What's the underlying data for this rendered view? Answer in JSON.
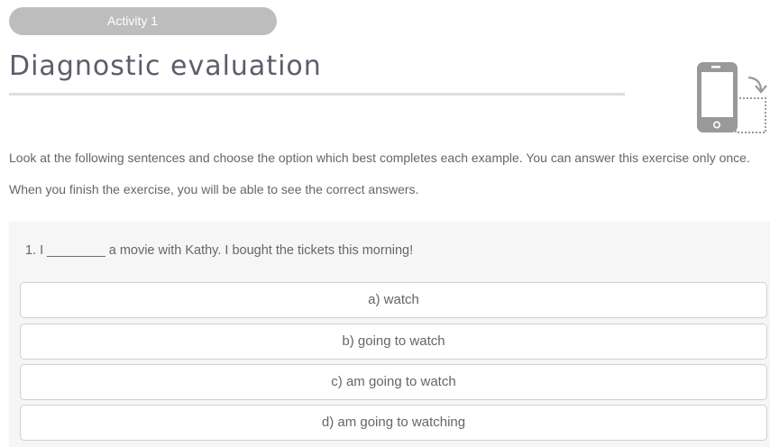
{
  "header": {
    "activity_label": "Activity 1",
    "title": "Diagnostic evaluation",
    "rotate_icon": "rotate-device-icon"
  },
  "instructions": "Look at the following sentences and choose the option which best completes each example. You can answer this exercise only once. When you finish the exercise, you will be able to see the correct answers.",
  "question": {
    "text": "1. I ________ a movie with Kathy. I bought the tickets this morning!",
    "options": [
      "a) watch",
      "b) going to watch",
      "c) am going to watch",
      "d) am going to watching"
    ]
  },
  "colors": {
    "pill": "#bdbdbd",
    "title": "#5d5d6b",
    "panel": "#f6f6f6",
    "option_border": "#d0d0d0"
  }
}
